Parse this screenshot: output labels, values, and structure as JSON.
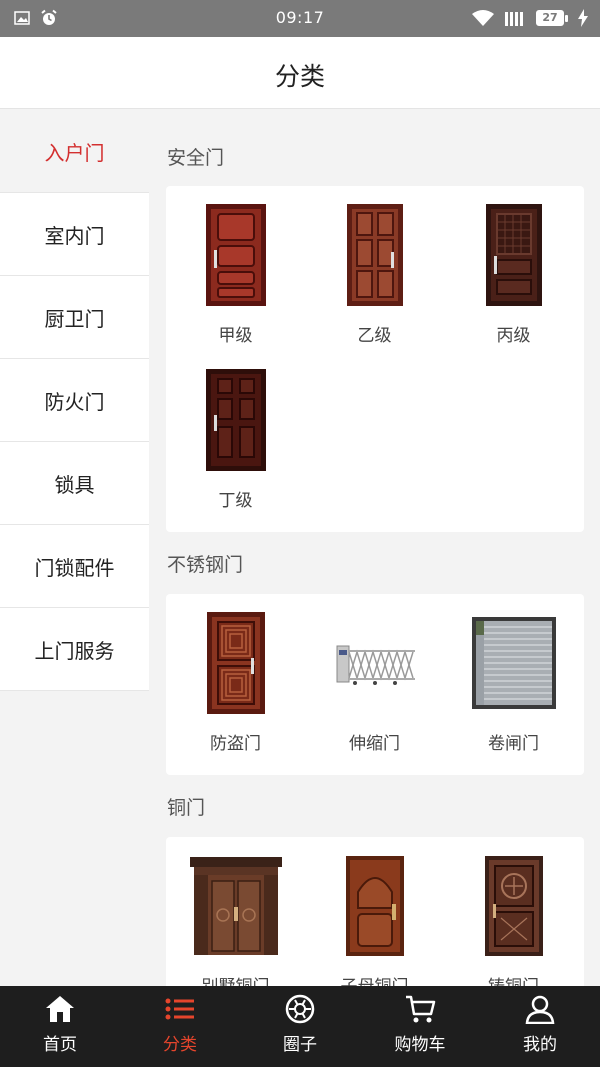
{
  "status": {
    "time": "09:17",
    "battery": "27"
  },
  "header": {
    "title": "分类"
  },
  "sidebar": {
    "items": [
      {
        "label": "入户门"
      },
      {
        "label": "室内门"
      },
      {
        "label": "厨卫门"
      },
      {
        "label": "防火门"
      },
      {
        "label": "锁具"
      },
      {
        "label": "门锁配件"
      },
      {
        "label": "上门服务"
      }
    ],
    "active_index": 0
  },
  "sections": [
    {
      "title": "安全门",
      "items": [
        {
          "label": "甲级"
        },
        {
          "label": "乙级"
        },
        {
          "label": "丙级"
        },
        {
          "label": "丁级"
        }
      ]
    },
    {
      "title": "不锈钢门",
      "items": [
        {
          "label": "防盗门"
        },
        {
          "label": "伸缩门"
        },
        {
          "label": "卷闸门"
        }
      ]
    },
    {
      "title": "铜门",
      "items": [
        {
          "label": "别墅铜门"
        },
        {
          "label": "子母铜门"
        },
        {
          "label": "铸铜门"
        }
      ]
    }
  ],
  "tabbar": {
    "items": [
      {
        "label": "首页",
        "icon": "home-icon"
      },
      {
        "label": "分类",
        "icon": "list-icon"
      },
      {
        "label": "圈子",
        "icon": "aperture-icon"
      },
      {
        "label": "购物车",
        "icon": "cart-icon"
      },
      {
        "label": "我的",
        "icon": "user-icon"
      }
    ],
    "active_index": 1
  },
  "colors": {
    "accent": "#d32f2f",
    "tab_active": "#e5452c",
    "tabbar_bg": "#1e1e1e",
    "statusbar_bg": "#7a7a7a"
  }
}
